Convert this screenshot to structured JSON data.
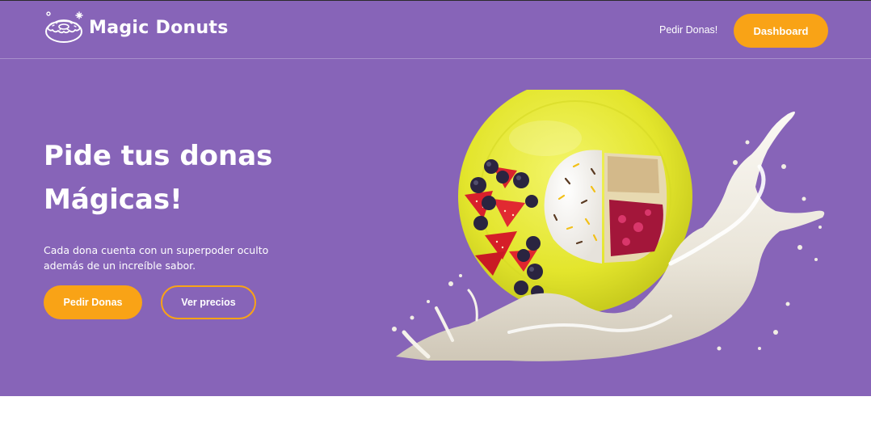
{
  "brand": {
    "name": "Magic Donuts",
    "logo_icon": "donut-logo-icon"
  },
  "nav": {
    "order_link": "Pedir Donas!",
    "dashboard_button": "Dashboard"
  },
  "hero": {
    "title_line1": "Pide tus donas",
    "title_line2": "Mágicas!",
    "subtitle": "Cada dona cuenta con un superpoder oculto además de un increíble sabor.",
    "primary_button": "Pedir Donas",
    "secondary_button": "Ver precios",
    "image_icon": "donut-plate-milk-splash-image"
  },
  "colors": {
    "background": "#8764b8",
    "accent": "#f9a316",
    "text": "#ffffff",
    "plate": "#e6e834"
  }
}
